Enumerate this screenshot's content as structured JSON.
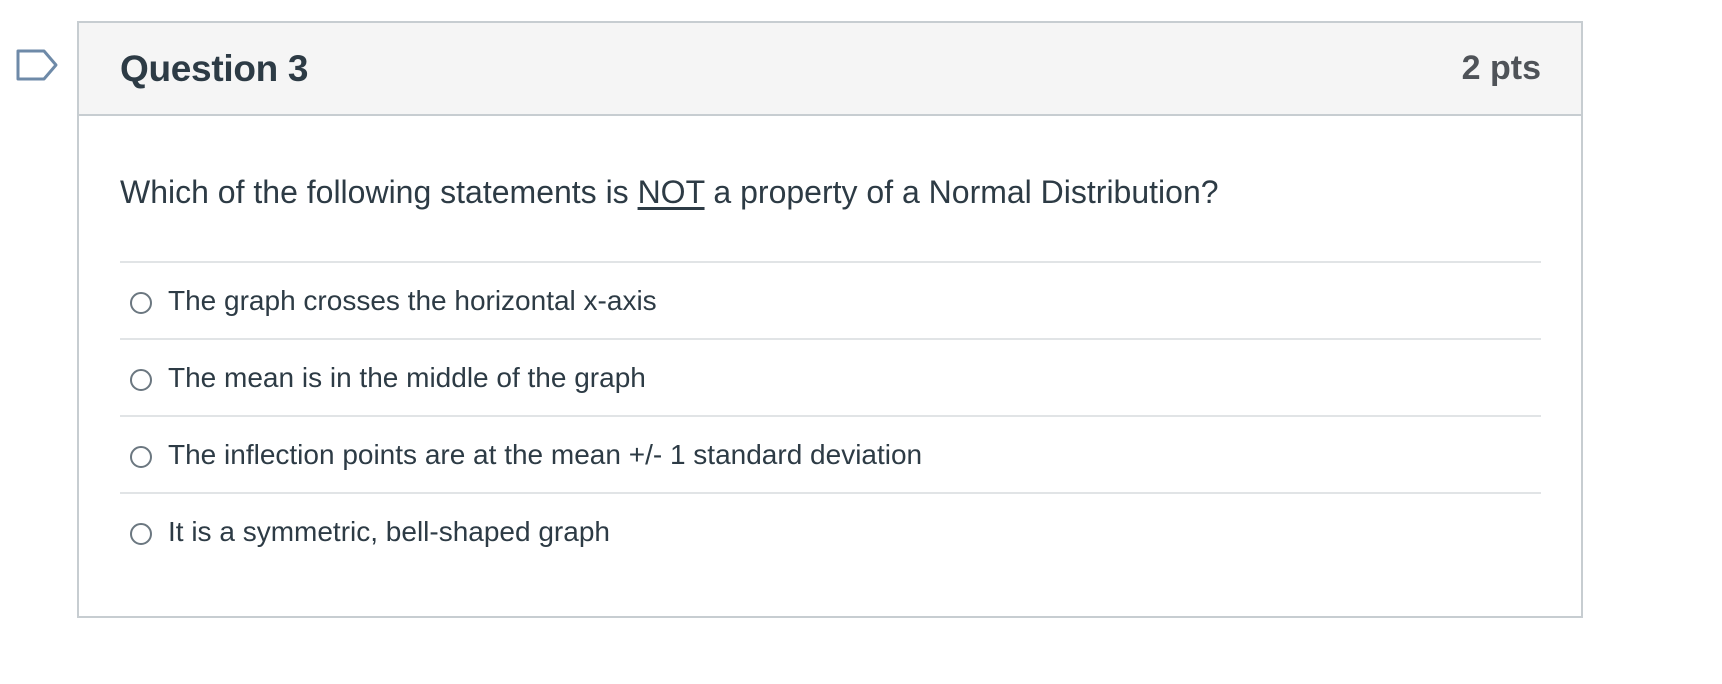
{
  "question": {
    "flag_icon": "bookmark-flag-icon",
    "title": "Question 3",
    "points": "2 pts",
    "text_before": "Which of the following statements is ",
    "text_emphasis": "NOT",
    "text_after": " a property of a Normal Distribution?",
    "answers": [
      {
        "label": "The graph crosses the horizontal x-axis"
      },
      {
        "label": "The mean is in the middle of the graph"
      },
      {
        "label": "The inflection points are at the mean +/- 1 standard deviation"
      },
      {
        "label": "It is a symmetric, bell-shaped graph"
      }
    ]
  },
  "colors": {
    "header_bg": "#f5f5f5",
    "border": "#c7cdd1",
    "text": "#2d3b45",
    "flag_stroke": "#6e8aa8"
  }
}
